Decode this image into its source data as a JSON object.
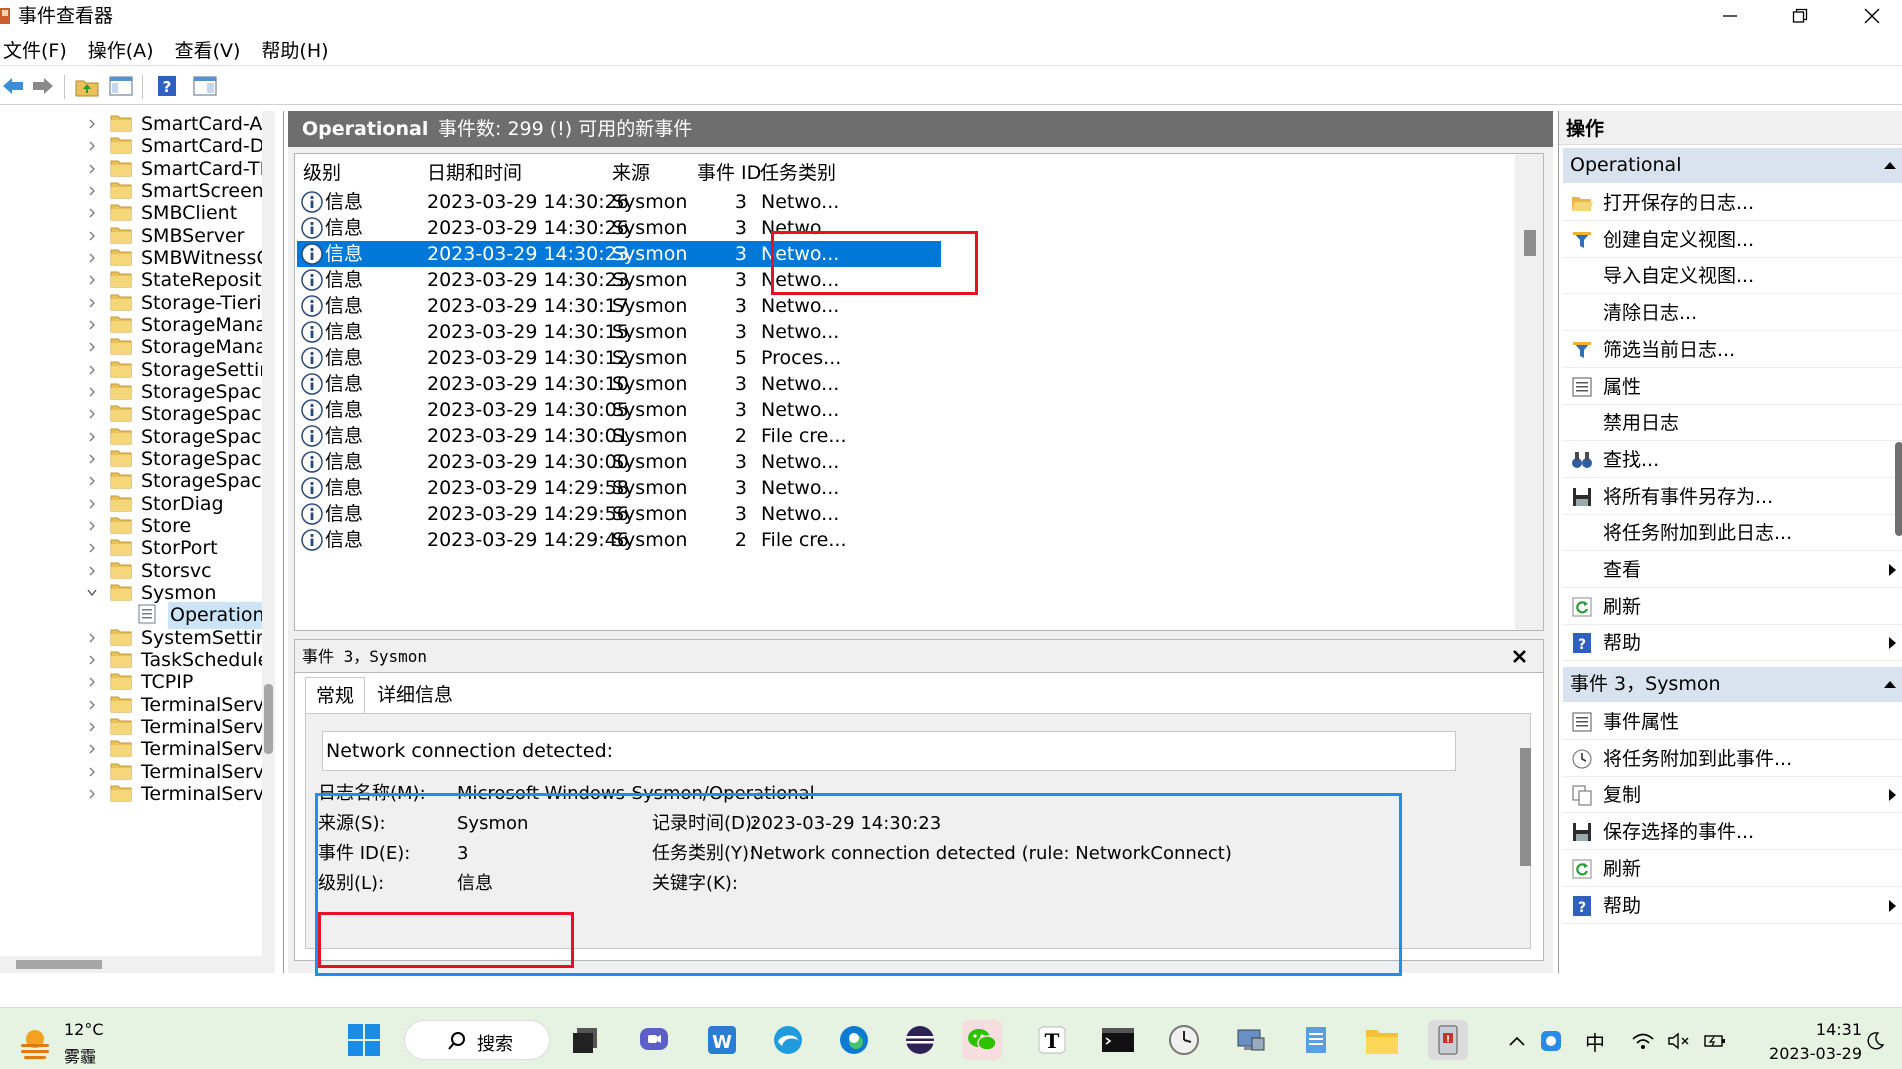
{
  "window": {
    "title": "事件查看器"
  },
  "menu": [
    "文件(F)",
    "操作(A)",
    "查看(V)",
    "帮助(H)"
  ],
  "tree": {
    "items": [
      {
        "label": "SmartCard-Au",
        "expanded": false
      },
      {
        "label": "SmartCard-De",
        "expanded": false
      },
      {
        "label": "SmartCard-TP",
        "expanded": false
      },
      {
        "label": "SmartScreen",
        "expanded": false
      },
      {
        "label": "SMBClient",
        "expanded": false
      },
      {
        "label": "SMBServer",
        "expanded": false
      },
      {
        "label": "SMBWitnessC",
        "expanded": false
      },
      {
        "label": "StateReposito",
        "expanded": false
      },
      {
        "label": "Storage-Tierir",
        "expanded": false
      },
      {
        "label": "StorageManag",
        "expanded": false
      },
      {
        "label": "StorageManag",
        "expanded": false
      },
      {
        "label": "StorageSettin",
        "expanded": false
      },
      {
        "label": "StorageSpace",
        "expanded": false
      },
      {
        "label": "StorageSpace",
        "expanded": false
      },
      {
        "label": "StorageSpace",
        "expanded": false
      },
      {
        "label": "StorageSpace",
        "expanded": false
      },
      {
        "label": "StorageSpace",
        "expanded": false
      },
      {
        "label": "StorDiag",
        "expanded": false
      },
      {
        "label": "Store",
        "expanded": false
      },
      {
        "label": "StorPort",
        "expanded": false
      },
      {
        "label": "Storsvc",
        "expanded": false
      },
      {
        "label": "Sysmon",
        "expanded": true
      },
      {
        "label": "Operational",
        "child": true,
        "selected": true
      },
      {
        "label": "SystemSetting",
        "expanded": false
      },
      {
        "label": "TaskSchedule",
        "expanded": false
      },
      {
        "label": "TCPIP",
        "expanded": false
      },
      {
        "label": "TerminalServi",
        "expanded": false
      },
      {
        "label": "TerminalServi",
        "expanded": false
      },
      {
        "label": "TerminalServi",
        "expanded": false
      },
      {
        "label": "TerminalServi",
        "expanded": false
      },
      {
        "label": "TerminalServi",
        "expanded": false
      }
    ]
  },
  "log": {
    "name": "Operational",
    "info": "事件数: 299 (!) 可用的新事件"
  },
  "grid": {
    "columns": [
      "级别",
      "日期和时间",
      "来源",
      "事件 ID",
      "任务类别"
    ],
    "rows": [
      {
        "level": "信息",
        "datetime": "2023-03-29 14:30:26",
        "source": "Sysmon",
        "event_id": "3",
        "task": "Netwo..."
      },
      {
        "level": "信息",
        "datetime": "2023-03-29 14:30:26",
        "source": "Sysmon",
        "event_id": "3",
        "task": "Netwo..."
      },
      {
        "level": "信息",
        "datetime": "2023-03-29 14:30:23",
        "source": "Sysmon",
        "event_id": "3",
        "task": "Netwo...",
        "selected": true
      },
      {
        "level": "信息",
        "datetime": "2023-03-29 14:30:23",
        "source": "Sysmon",
        "event_id": "3",
        "task": "Netwo..."
      },
      {
        "level": "信息",
        "datetime": "2023-03-29 14:30:17",
        "source": "Sysmon",
        "event_id": "3",
        "task": "Netwo..."
      },
      {
        "level": "信息",
        "datetime": "2023-03-29 14:30:15",
        "source": "Sysmon",
        "event_id": "3",
        "task": "Netwo..."
      },
      {
        "level": "信息",
        "datetime": "2023-03-29 14:30:12",
        "source": "Sysmon",
        "event_id": "5",
        "task": "Proces..."
      },
      {
        "level": "信息",
        "datetime": "2023-03-29 14:30:10",
        "source": "Sysmon",
        "event_id": "3",
        "task": "Netwo..."
      },
      {
        "level": "信息",
        "datetime": "2023-03-29 14:30:05",
        "source": "Sysmon",
        "event_id": "3",
        "task": "Netwo..."
      },
      {
        "level": "信息",
        "datetime": "2023-03-29 14:30:01",
        "source": "Sysmon",
        "event_id": "2",
        "task": "File cre..."
      },
      {
        "level": "信息",
        "datetime": "2023-03-29 14:30:00",
        "source": "Sysmon",
        "event_id": "3",
        "task": "Netwo..."
      },
      {
        "level": "信息",
        "datetime": "2023-03-29 14:29:58",
        "source": "Sysmon",
        "event_id": "3",
        "task": "Netwo..."
      },
      {
        "level": "信息",
        "datetime": "2023-03-29 14:29:56",
        "source": "Sysmon",
        "event_id": "3",
        "task": "Netwo..."
      },
      {
        "level": "信息",
        "datetime": "2023-03-29 14:29:46",
        "source": "Sysmon",
        "event_id": "2",
        "task": "File cre..."
      }
    ]
  },
  "detail": {
    "title": "事件 3，Sysmon",
    "tabs": [
      "常规",
      "详细信息"
    ],
    "description": "Network connection detected:",
    "fields": {
      "log_name_label": "日志名称(M):",
      "log_name": "Microsoft-Windows-Sysmon/Operational",
      "source_label": "来源(S):",
      "source": "Sysmon",
      "recorded_label": "记录时间(D):",
      "recorded": "2023-03-29 14:30:23",
      "event_id_label": "事件 ID(E):",
      "event_id": "3",
      "task_label": "任务类别(Y):",
      "task": "Network connection detected (rule: NetworkConnect)",
      "level_label": "级别(L):",
      "level": "信息",
      "keywords_label": "关键字(K):"
    }
  },
  "actions": {
    "title": "操作",
    "section1": {
      "title": "Operational",
      "items": [
        {
          "label": "打开保存的日志...",
          "icon": "folder-open-icon"
        },
        {
          "label": "创建自定义视图...",
          "icon": "filter-icon"
        },
        {
          "label": "导入自定义视图...",
          "icon": ""
        },
        {
          "label": "清除日志...",
          "icon": ""
        },
        {
          "label": "筛选当前日志...",
          "icon": "filter-icon"
        },
        {
          "label": "属性",
          "icon": "properties-icon"
        },
        {
          "label": "禁用日志",
          "icon": ""
        },
        {
          "label": "查找...",
          "icon": "binoculars-icon"
        },
        {
          "label": "将所有事件另存为...",
          "icon": "save-icon"
        },
        {
          "label": "将任务附加到此日志...",
          "icon": ""
        },
        {
          "label": "查看",
          "icon": "",
          "submenu": true
        },
        {
          "label": "刷新",
          "icon": "refresh-icon"
        },
        {
          "label": "帮助",
          "icon": "help-icon",
          "submenu": true
        }
      ]
    },
    "section2": {
      "title": "事件 3，Sysmon",
      "items": [
        {
          "label": "事件属性",
          "icon": "properties-icon"
        },
        {
          "label": "将任务附加到此事件...",
          "icon": "task-icon"
        },
        {
          "label": "复制",
          "icon": "copy-icon",
          "submenu": true
        },
        {
          "label": "保存选择的事件...",
          "icon": "save-icon"
        },
        {
          "label": "刷新",
          "icon": "refresh-icon"
        },
        {
          "label": "帮助",
          "icon": "help-icon",
          "submenu": true
        }
      ]
    }
  },
  "taskbar": {
    "weather": {
      "temp": "12°C",
      "desc": "雾霾"
    },
    "search_label": "搜索",
    "tray_lang": "中",
    "time": "14:31",
    "date": "2023-03-29"
  },
  "colors": {
    "selection": "#0078d7",
    "annotation_red": "#e81123",
    "annotation_blue": "#1d8ff0",
    "header_gray": "#6e6e6e"
  }
}
